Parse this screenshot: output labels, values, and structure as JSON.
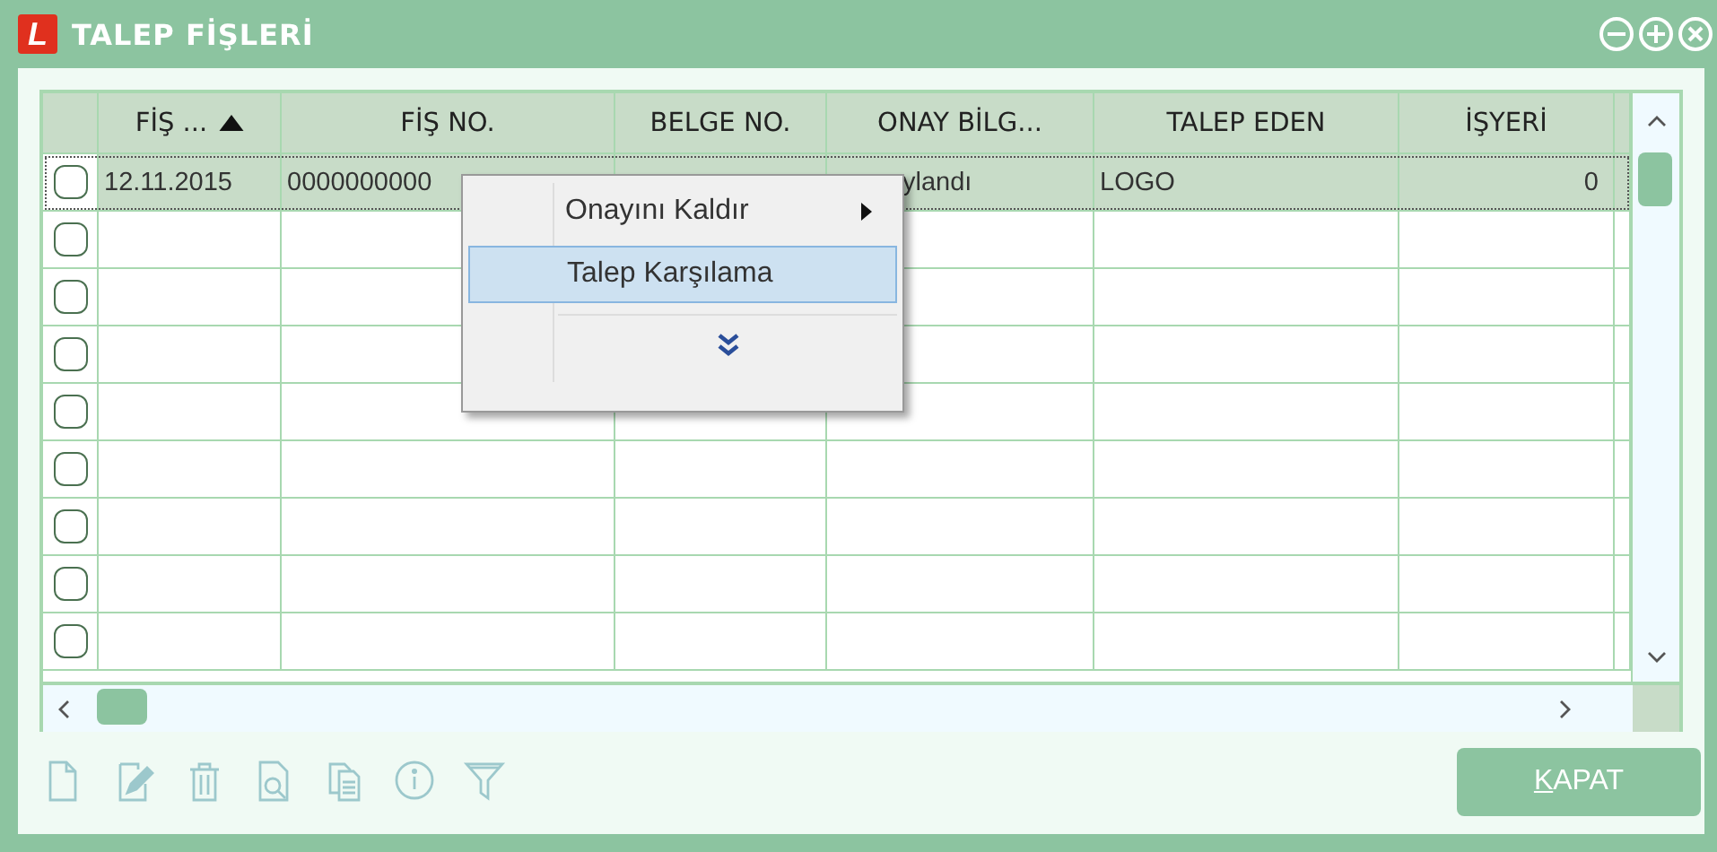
{
  "window": {
    "logo": "L",
    "title": "TALEP FİŞLERİ",
    "controls": [
      {
        "kind": "minimize"
      },
      {
        "kind": "maximize"
      },
      {
        "kind": "close"
      }
    ]
  },
  "table": {
    "columns": [
      {
        "label": "FİŞ ...",
        "sorted": true
      },
      {
        "label": "FİŞ NO.",
        "sorted": false
      },
      {
        "label": "BELGE NO.",
        "sorted": false
      },
      {
        "label": "ONAY BİLG...",
        "sorted": false
      },
      {
        "label": "TALEP EDEN",
        "sorted": false
      },
      {
        "label": "İŞYERİ",
        "sorted": false
      }
    ],
    "rows": [
      {
        "selected": true,
        "checked": false,
        "cells": [
          "12.11.2015",
          "0000000000",
          "",
          "ylandı",
          "LOGO",
          "0"
        ]
      },
      {
        "selected": false,
        "checked": false
      },
      {
        "selected": false,
        "checked": false
      },
      {
        "selected": false,
        "checked": false
      },
      {
        "selected": false,
        "checked": false
      },
      {
        "selected": false,
        "checked": false
      },
      {
        "selected": false,
        "checked": false
      },
      {
        "selected": false,
        "checked": false
      },
      {
        "selected": false,
        "checked": false
      }
    ]
  },
  "context_menu": {
    "items": [
      {
        "label": "Onayını Kaldır",
        "submenu": true,
        "selected": false
      },
      {
        "label": "Talep Karşılama",
        "submenu": false,
        "selected": true
      }
    ],
    "more": true
  },
  "toolbar": [
    {
      "kind": "new",
      "disabled": true
    },
    {
      "kind": "edit",
      "disabled": true
    },
    {
      "kind": "delete",
      "disabled": true
    },
    {
      "kind": "preview",
      "disabled": true
    },
    {
      "kind": "copy",
      "disabled": true
    },
    {
      "kind": "info",
      "disabled": true
    },
    {
      "kind": "filter",
      "disabled": true
    }
  ],
  "close_button": {
    "label": "KAPAT",
    "mnemonic_underlined": true
  }
}
